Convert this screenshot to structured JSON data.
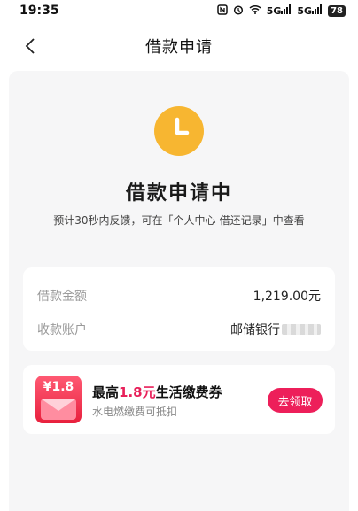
{
  "status_bar": {
    "time": "19:35",
    "icons": [
      "nfc-icon",
      "alarm-icon",
      "wifi-icon",
      "signal-icon",
      "signal-icon"
    ],
    "signal1_label": "5G",
    "signal2_label": "5G",
    "battery": "78"
  },
  "nav": {
    "title": "借款申请",
    "back_icon": "chevron-left-icon"
  },
  "status": {
    "icon": "clock-icon",
    "icon_color": "#f7b631",
    "title": "借款申请中",
    "subtitle": "预计30秒内反馈，可在「个人中心-借还记录」中查看"
  },
  "info": {
    "rows": [
      {
        "label": "借款金额",
        "value": "1,219.00元"
      },
      {
        "label": "收款账户",
        "value": "邮储银行"
      }
    ]
  },
  "coupon": {
    "badge_amount": "¥1.8",
    "title_prefix": "最高",
    "title_highlight": "1.8元",
    "title_suffix": "生活缴费券",
    "description": "水电燃缴费可抵扣",
    "button_label": "去领取",
    "accent_color": "#ed1f5a"
  }
}
